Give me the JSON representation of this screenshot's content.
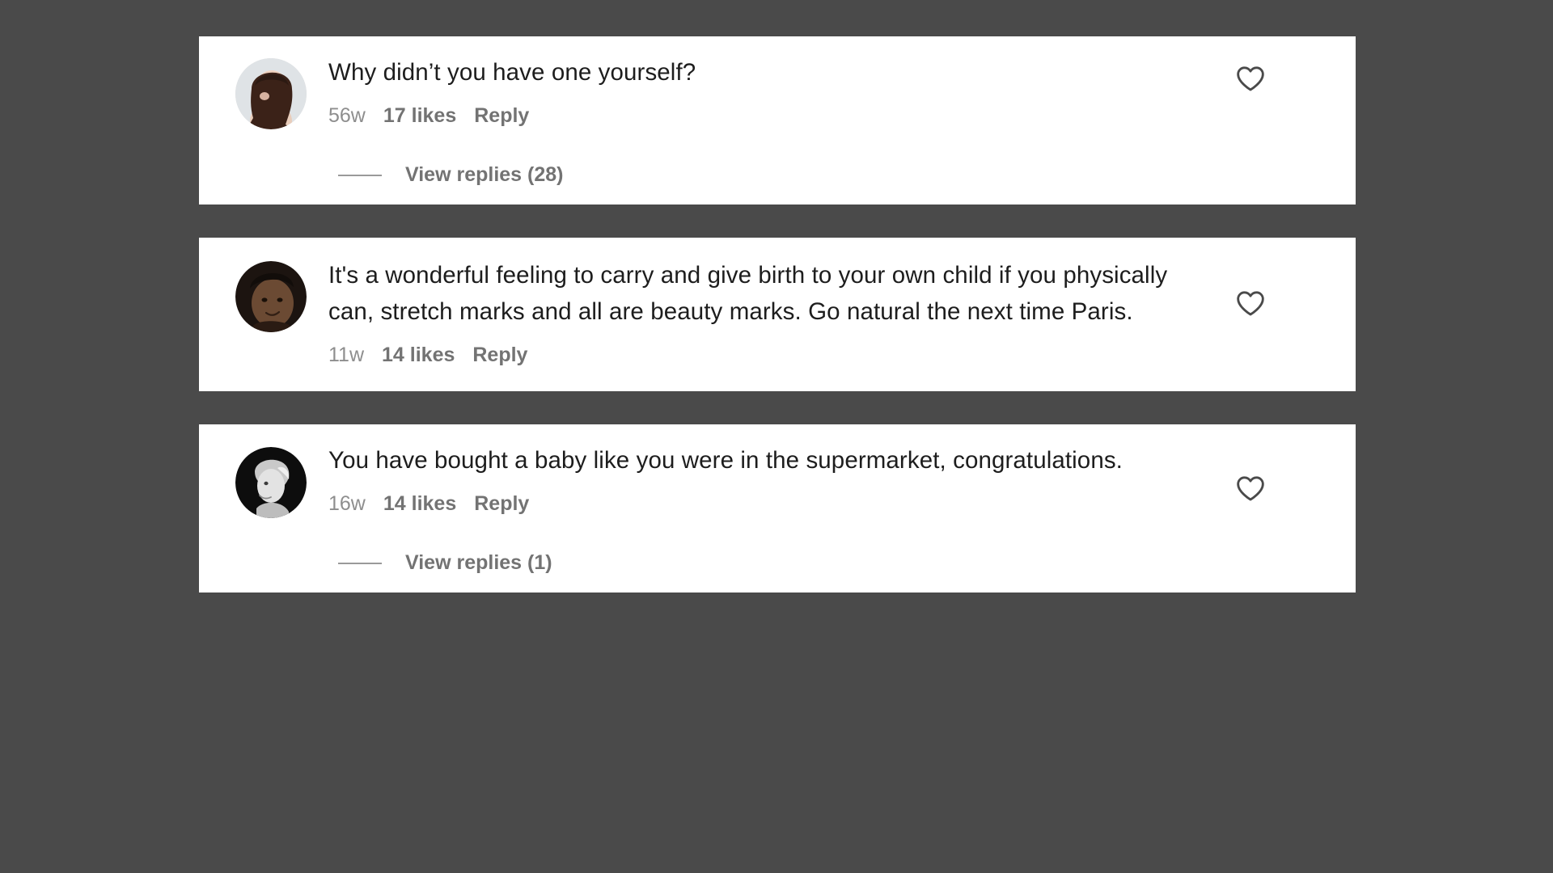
{
  "app": {
    "name": "instagram-comments",
    "background_color": "#4a4a4a",
    "card_color": "#ffffff"
  },
  "comments": [
    {
      "avatar_name": "avatar-user-1",
      "text": "Why didn’t you have one yourself?",
      "time": "56w",
      "likes": "17 likes",
      "reply_label": "Reply",
      "view_replies_label": "View replies (28)",
      "has_replies": true,
      "like_icon": "heart-outline-icon"
    },
    {
      "avatar_name": "avatar-user-2",
      "text": "It's a wonderful feeling to carry and give birth to your own child if you physically can, stretch marks and all are beauty marks. Go natural the next time Paris.",
      "time": "11w",
      "likes": "14 likes",
      "reply_label": "Reply",
      "view_replies_label": "",
      "has_replies": false,
      "like_icon": "heart-outline-icon"
    },
    {
      "avatar_name": "avatar-user-3",
      "text": "You have bought a baby like you were in the supermarket, congratulations.",
      "time": "16w",
      "likes": "14 likes",
      "reply_label": "Reply",
      "view_replies_label": "View replies (1)",
      "has_replies": true,
      "like_icon": "heart-outline-icon"
    }
  ],
  "colors": {
    "text_primary": "#1d1d1d",
    "text_muted": "#8e8e8e",
    "text_action": "#737373",
    "heart_stroke": "#4a4a4a"
  }
}
